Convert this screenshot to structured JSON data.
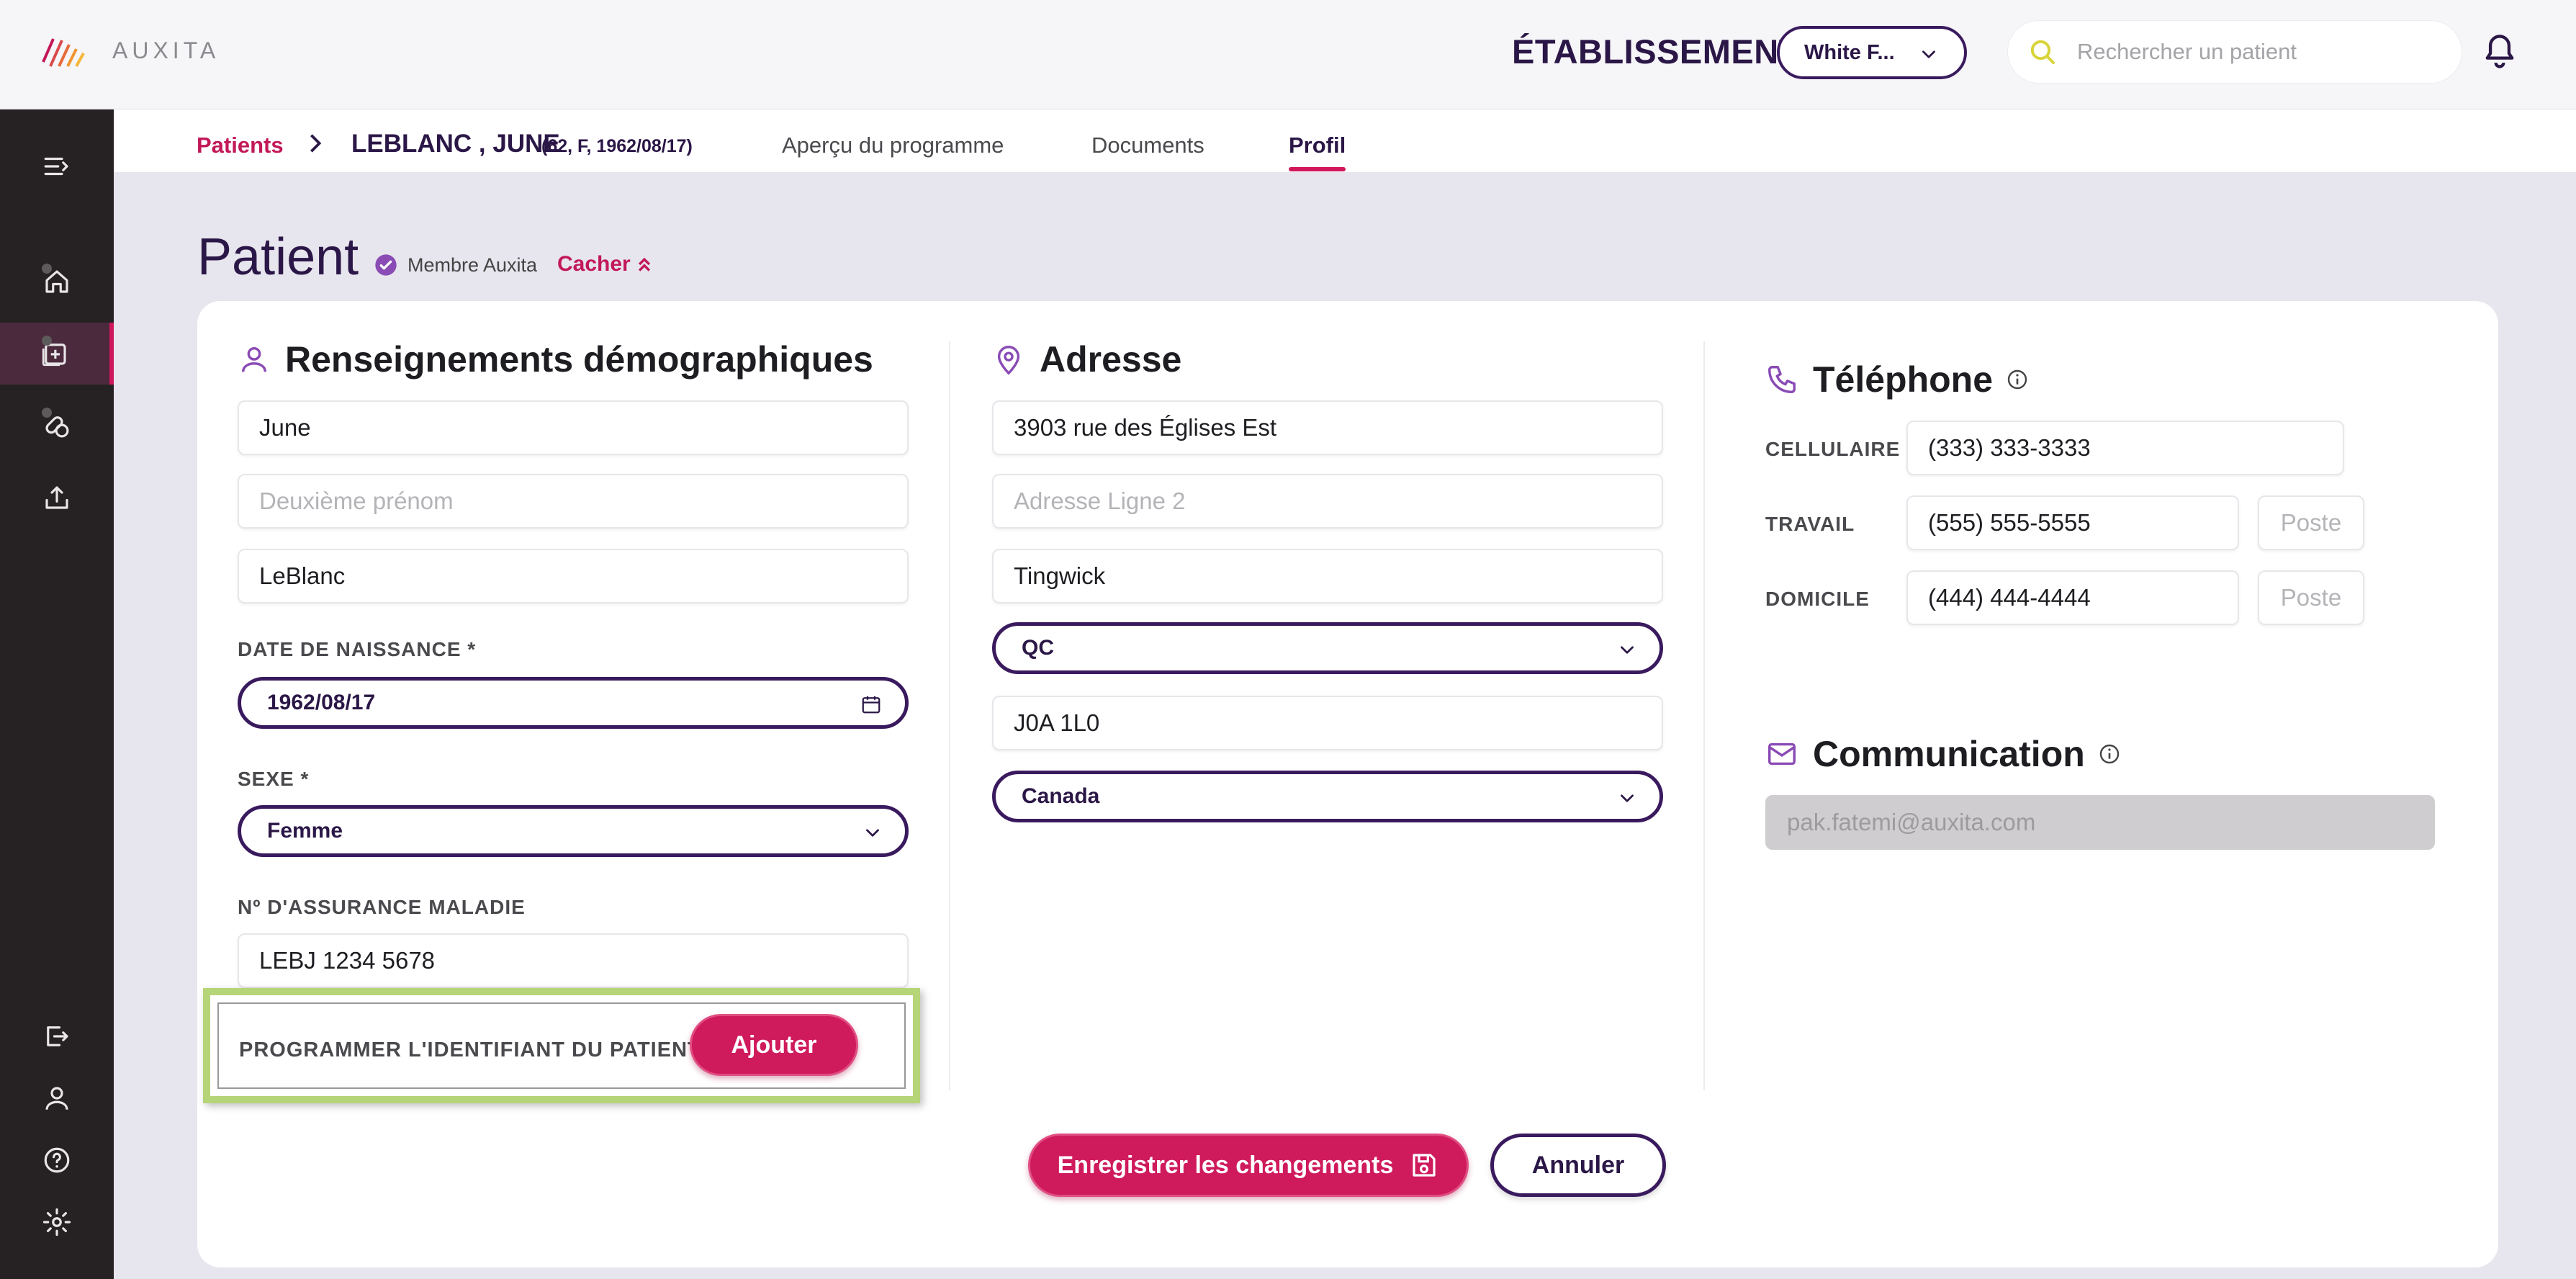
{
  "brand": {
    "name": "AUXITA"
  },
  "header": {
    "establishment_label": "ÉTABLISSEMENT",
    "establishment_value": "White F...",
    "search_placeholder": "Rechercher un patient"
  },
  "breadcrumb": {
    "patients": "Patients",
    "patient_name": "LEBLANC , JUNE",
    "patient_meta": "(62, F, 1962/08/17)"
  },
  "tabs": [
    {
      "label": "Aperçu du programme",
      "active": false
    },
    {
      "label": "Documents",
      "active": false
    },
    {
      "label": "Profil",
      "active": true
    }
  ],
  "page": {
    "title": "Patient",
    "member_badge": "Membre Auxita",
    "hide_link": "Cacher"
  },
  "demographics": {
    "title": "Renseignements démographiques",
    "first_name": "June",
    "middle_name_placeholder": "Deuxième prénom",
    "last_name": "LeBlanc",
    "dob_label": "DATE DE NAISSANCE *",
    "dob_value": "1962/08/17",
    "sex_label": "SEXE *",
    "sex_value": "Femme",
    "health_label": "Nº D'ASSURANCE MALADIE",
    "health_value": "LEBJ 1234 5678",
    "patient_id_label": "PROGRAMMER L'IDENTIFIANT DU PATIENT",
    "patient_id_button": "Ajouter"
  },
  "address": {
    "title": "Adresse",
    "line1": "3903 rue des Églises Est",
    "line2_placeholder": "Adresse Ligne 2",
    "city": "Tingwick",
    "province": "QC",
    "postal_code": "J0A 1L0",
    "country": "Canada"
  },
  "phone": {
    "title": "Téléphone",
    "cell_label": "CELLULAIRE",
    "cell_value": "(333) 333-3333",
    "work_label": "TRAVAIL",
    "work_value": "(555) 555-5555",
    "home_label": "DOMICILE",
    "home_value": "(444) 444-4444",
    "ext_placeholder": "Poste"
  },
  "communication": {
    "title": "Communication",
    "email": "pak.fatemi@auxita.com"
  },
  "actions": {
    "save": "Enregistrer les changements",
    "cancel": "Annuler"
  },
  "colors": {
    "accent": "#cf1a5c",
    "primary_dark": "#2b1747",
    "sidebar": "#262223",
    "highlight_box": "#b6d478"
  },
  "icons": {
    "sidebar": [
      "menu-expand-icon",
      "home-icon",
      "patient-record-icon",
      "pills-icon",
      "upload-icon",
      "logout-icon",
      "user-icon",
      "help-icon",
      "settings-icon"
    ]
  }
}
